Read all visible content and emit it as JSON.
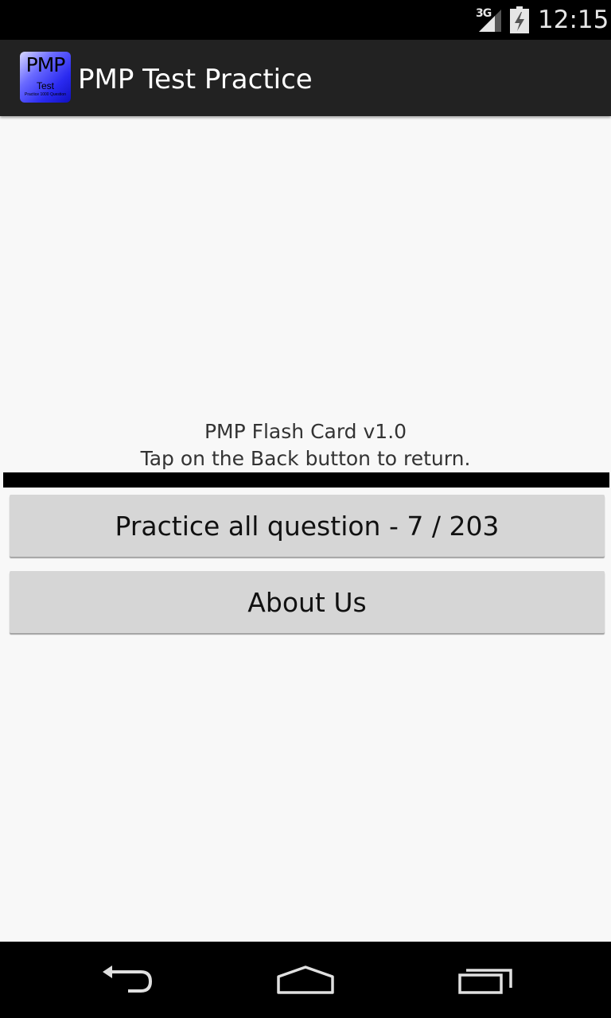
{
  "status_bar": {
    "network_type": "3G",
    "time": "12:15",
    "icons": [
      "signal-icon",
      "battery-charging-icon"
    ]
  },
  "action_bar": {
    "app_icon": {
      "big_text": "PMP",
      "small_text": "Test",
      "tiny_text": "Practice 1000 Question"
    },
    "title": "PMP Test Practice"
  },
  "info": {
    "line1": "PMP Flash Card v1.0",
    "line2": "Tap on the Back button to return."
  },
  "buttons": {
    "practice_label": "Practice all question - 7 / 203",
    "about_label": "About Us"
  },
  "nav_bar": {
    "icons": [
      "back-icon",
      "home-icon",
      "recents-icon"
    ]
  },
  "colors": {
    "status_bar": "#000000",
    "action_bar": "#222222",
    "background": "#f8f8f8",
    "button": "#d6d6d6"
  }
}
